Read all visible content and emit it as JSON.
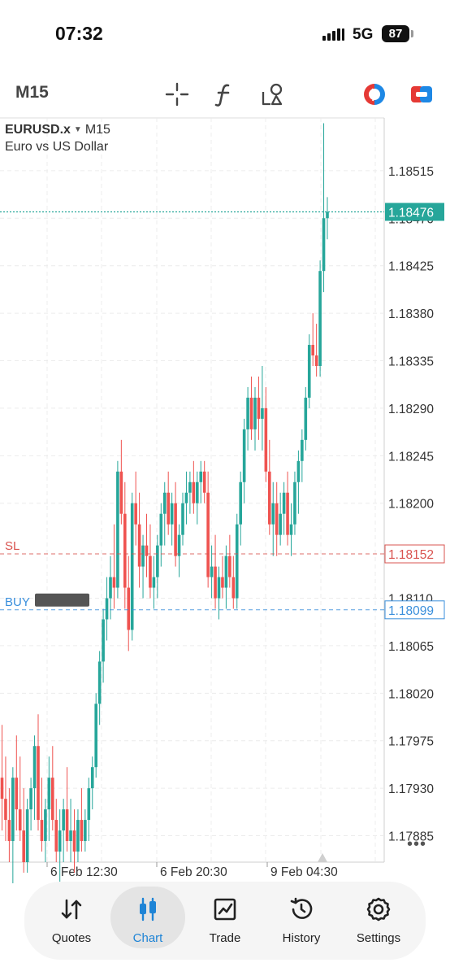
{
  "status_bar": {
    "time": "07:32",
    "network": "5G",
    "battery": "87"
  },
  "toolbar": {
    "timeframe": "M15",
    "tools": [
      {
        "icon": "crosshair-icon"
      },
      {
        "icon": "indicators-icon"
      },
      {
        "icon": "objects-icon"
      },
      {
        "icon": "one-click-trading-icon"
      },
      {
        "icon": "account-switch-icon"
      }
    ]
  },
  "chart": {
    "symbol": "EURUSD.x",
    "caret": "▼",
    "timeframe": "M15",
    "description": "Euro vs US Dollar",
    "colors": {
      "up": "#26a69a",
      "down": "#ef5350",
      "current": "#26a69a",
      "sl": "#d9534f",
      "buy": "#3a8fdc"
    }
  },
  "chart_data": {
    "type": "candlestick",
    "ylim": [
      1.1786,
      1.18565
    ],
    "y_ticks": [
      "1.18515",
      "1.18470",
      "1.18425",
      "1.18380",
      "1.18335",
      "1.18290",
      "1.18245",
      "1.18200",
      "1.18110",
      "1.18065",
      "1.18020",
      "1.17975",
      "1.17930",
      "1.17885"
    ],
    "x_labels": [
      "6 Feb 12:30",
      "6 Feb 20:30",
      "9 Feb 04:30"
    ],
    "current_price": "1.18476",
    "lines": [
      {
        "label": "SL",
        "price": "1.18152",
        "color": "#d9534f"
      },
      {
        "label": "BUY",
        "price": "1.18099",
        "color": "#3a8fdc"
      }
    ],
    "candles": [
      [
        1.1794,
        1.1799,
        1.1789,
        1.1792
      ],
      [
        1.1792,
        1.1796,
        1.1788,
        1.179
      ],
      [
        1.179,
        1.1793,
        1.1786,
        1.1788
      ],
      [
        1.1788,
        1.1795,
        1.1784,
        1.1794
      ],
      [
        1.1794,
        1.1798,
        1.1789,
        1.1791
      ],
      [
        1.1791,
        1.1796,
        1.1788,
        1.1789
      ],
      [
        1.1789,
        1.1793,
        1.1785,
        1.1786
      ],
      [
        1.1786,
        1.1792,
        1.1785,
        1.1791
      ],
      [
        1.1791,
        1.1794,
        1.1789,
        1.1793
      ],
      [
        1.1793,
        1.1798,
        1.179,
        1.1797
      ],
      [
        1.1797,
        1.18,
        1.1789,
        1.179
      ],
      [
        1.179,
        1.1794,
        1.1787,
        1.1788
      ],
      [
        1.1788,
        1.1792,
        1.1786,
        1.1791
      ],
      [
        1.1791,
        1.1796,
        1.1788,
        1.1794
      ],
      [
        1.1794,
        1.1797,
        1.1789,
        1.179
      ],
      [
        1.179,
        1.1792,
        1.1786,
        1.1787
      ],
      [
        1.1787,
        1.1791,
        1.1784,
        1.1789
      ],
      [
        1.1789,
        1.1792,
        1.1786,
        1.1791
      ],
      [
        1.1791,
        1.1795,
        1.1787,
        1.1788
      ],
      [
        1.1788,
        1.1792,
        1.1786,
        1.1789
      ],
      [
        1.1789,
        1.1791,
        1.1785,
        1.1787
      ],
      [
        1.1787,
        1.1791,
        1.1786,
        1.179
      ],
      [
        1.179,
        1.1793,
        1.1787,
        1.1788
      ],
      [
        1.1788,
        1.1791,
        1.1787,
        1.179
      ],
      [
        1.179,
        1.1794,
        1.1788,
        1.1793
      ],
      [
        1.1793,
        1.1796,
        1.1791,
        1.1795
      ],
      [
        1.1795,
        1.1802,
        1.1794,
        1.1801
      ],
      [
        1.1801,
        1.1806,
        1.1799,
        1.1805
      ],
      [
        1.1805,
        1.181,
        1.1803,
        1.1809
      ],
      [
        1.1809,
        1.1813,
        1.1807,
        1.1811
      ],
      [
        1.1811,
        1.1815,
        1.1809,
        1.1813
      ],
      [
        1.1813,
        1.1818,
        1.181,
        1.1812
      ],
      [
        1.1812,
        1.1824,
        1.1811,
        1.1823
      ],
      [
        1.1823,
        1.1826,
        1.1818,
        1.1819
      ],
      [
        1.1819,
        1.1822,
        1.181,
        1.1812
      ],
      [
        1.1812,
        1.1815,
        1.1806,
        1.1808
      ],
      [
        1.1808,
        1.1821,
        1.1807,
        1.182
      ],
      [
        1.182,
        1.1823,
        1.1816,
        1.1818
      ],
      [
        1.1818,
        1.1821,
        1.1812,
        1.1814
      ],
      [
        1.1814,
        1.1817,
        1.1811,
        1.1816
      ],
      [
        1.1816,
        1.1819,
        1.1813,
        1.1815
      ],
      [
        1.1815,
        1.1818,
        1.1811,
        1.1812
      ],
      [
        1.1812,
        1.1815,
        1.181,
        1.1813
      ],
      [
        1.1813,
        1.1817,
        1.1811,
        1.1816
      ],
      [
        1.1816,
        1.182,
        1.1814,
        1.1819
      ],
      [
        1.1819,
        1.1822,
        1.1816,
        1.1821
      ],
      [
        1.1821,
        1.1823,
        1.1817,
        1.1818
      ],
      [
        1.1818,
        1.1821,
        1.1816,
        1.182
      ],
      [
        1.182,
        1.1822,
        1.1814,
        1.1815
      ],
      [
        1.1815,
        1.1818,
        1.1813,
        1.1817
      ],
      [
        1.1817,
        1.1821,
        1.1816,
        1.182
      ],
      [
        1.182,
        1.1823,
        1.1818,
        1.1821
      ],
      [
        1.1821,
        1.1823,
        1.1819,
        1.1822
      ],
      [
        1.1822,
        1.1824,
        1.1819,
        1.182
      ],
      [
        1.182,
        1.1823,
        1.1818,
        1.1822
      ],
      [
        1.1822,
        1.1824,
        1.182,
        1.1823
      ],
      [
        1.1823,
        1.1824,
        1.182,
        1.1821
      ],
      [
        1.1821,
        1.1823,
        1.1812,
        1.1813
      ],
      [
        1.1813,
        1.1816,
        1.1811,
        1.1814
      ],
      [
        1.1814,
        1.1817,
        1.181,
        1.1811
      ],
      [
        1.1811,
        1.1814,
        1.1809,
        1.1813
      ],
      [
        1.1813,
        1.1815,
        1.1811,
        1.1812
      ],
      [
        1.1812,
        1.1816,
        1.181,
        1.1815
      ],
      [
        1.1815,
        1.1817,
        1.1812,
        1.1813
      ],
      [
        1.1813,
        1.1815,
        1.181,
        1.1811
      ],
      [
        1.1811,
        1.1819,
        1.181,
        1.1818
      ],
      [
        1.1818,
        1.1823,
        1.1816,
        1.1822
      ],
      [
        1.1822,
        1.1828,
        1.182,
        1.1827
      ],
      [
        1.1827,
        1.1831,
        1.1825,
        1.183
      ],
      [
        1.183,
        1.1832,
        1.1826,
        1.1827
      ],
      [
        1.1827,
        1.1831,
        1.1825,
        1.183
      ],
      [
        1.183,
        1.1832,
        1.1826,
        1.1828
      ],
      [
        1.1828,
        1.1833,
        1.1825,
        1.1829
      ],
      [
        1.1829,
        1.1831,
        1.1822,
        1.1823
      ],
      [
        1.1823,
        1.1826,
        1.1817,
        1.1818
      ],
      [
        1.1818,
        1.1822,
        1.1815,
        1.182
      ],
      [
        1.182,
        1.1822,
        1.1815,
        1.1817
      ],
      [
        1.1817,
        1.1821,
        1.1816,
        1.1819
      ],
      [
        1.1819,
        1.1822,
        1.1817,
        1.1821
      ],
      [
        1.1821,
        1.1823,
        1.1816,
        1.1817
      ],
      [
        1.1817,
        1.182,
        1.1815,
        1.1818
      ],
      [
        1.1818,
        1.1823,
        1.1817,
        1.1822
      ],
      [
        1.1822,
        1.1825,
        1.1819,
        1.1824
      ],
      [
        1.1824,
        1.1827,
        1.1822,
        1.1826
      ],
      [
        1.1826,
        1.1831,
        1.1825,
        1.183
      ],
      [
        1.183,
        1.1836,
        1.1829,
        1.1835
      ],
      [
        1.1835,
        1.1838,
        1.1833,
        1.1834
      ],
      [
        1.1834,
        1.1837,
        1.1832,
        1.1833
      ],
      [
        1.1833,
        1.1843,
        1.1832,
        1.1842
      ],
      [
        1.1842,
        1.1856,
        1.184,
        1.1847
      ],
      [
        1.1847,
        1.1849,
        1.1845,
        1.18476
      ]
    ]
  },
  "nav": {
    "items": [
      {
        "label": "Quotes",
        "icon": "quotes-arrows-icon"
      },
      {
        "label": "Chart",
        "icon": "candles-chart-icon",
        "active": true
      },
      {
        "label": "Trade",
        "icon": "trade-chart-icon"
      },
      {
        "label": "History",
        "icon": "history-icon"
      },
      {
        "label": "Settings",
        "icon": "gear-icon"
      }
    ]
  }
}
